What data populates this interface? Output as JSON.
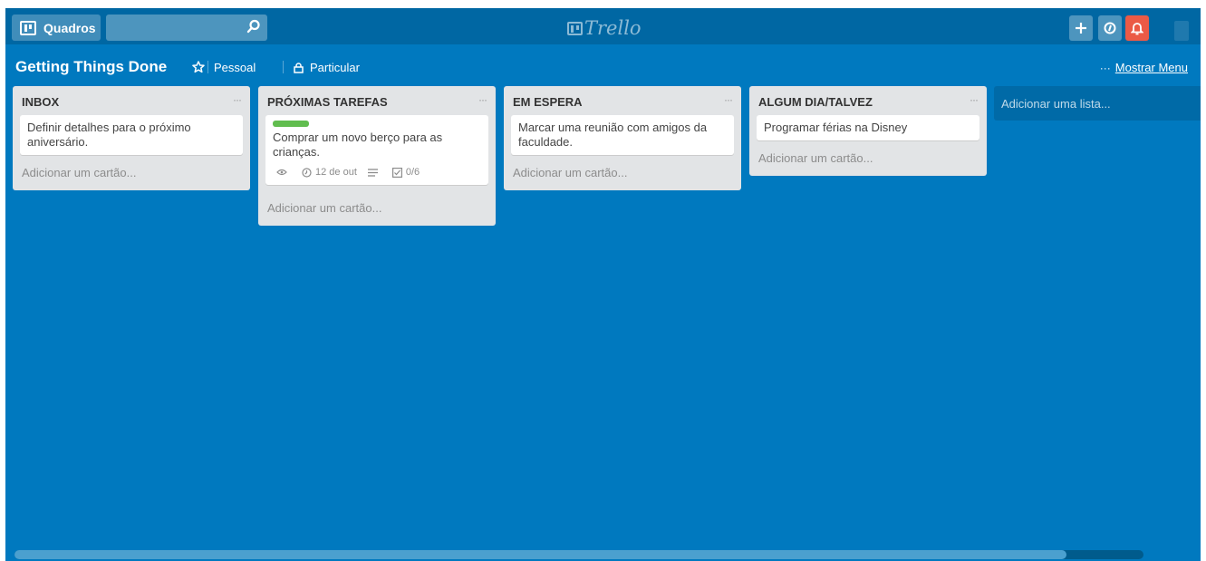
{
  "header": {
    "boards_label": "Quadros",
    "search_value": "",
    "logo_text": "Trello",
    "add_icon": "plus-icon",
    "info_icon": "info-icon",
    "notification_icon": "bell-icon",
    "notification_color": "#eb5a46"
  },
  "board": {
    "title": "Getting Things Done",
    "team": "Pessoal",
    "privacy": "Particular",
    "menu_dots": "···",
    "menu_label": "Mostrar Menu",
    "background_color": "#0079bf"
  },
  "lists": [
    {
      "name": "INBOX",
      "menu": "···",
      "cards": [
        {
          "title": "Definir detalhes para o próximo aniversário."
        }
      ],
      "add_card": "Adicionar um cartão..."
    },
    {
      "name": "PRÓXIMAS TAREFAS",
      "menu": "···",
      "cards": [
        {
          "label_color": "#61bd4f",
          "title": "Comprar um novo berço para as crianças.",
          "due": "12 de out",
          "checklist": "0/6"
        }
      ],
      "add_card": "Adicionar um cartão..."
    },
    {
      "name": "EM ESPERA",
      "menu": "···",
      "cards": [
        {
          "title": "Marcar uma reunião com amigos da faculdade."
        }
      ],
      "add_card": "Adicionar um cartão..."
    },
    {
      "name": "ALGUM DIA/TALVEZ",
      "menu": "···",
      "cards": [
        {
          "title": "Programar férias na Disney"
        }
      ],
      "add_card": "Adicionar um cartão..."
    }
  ],
  "add_list_label": "Adicionar uma lista..."
}
